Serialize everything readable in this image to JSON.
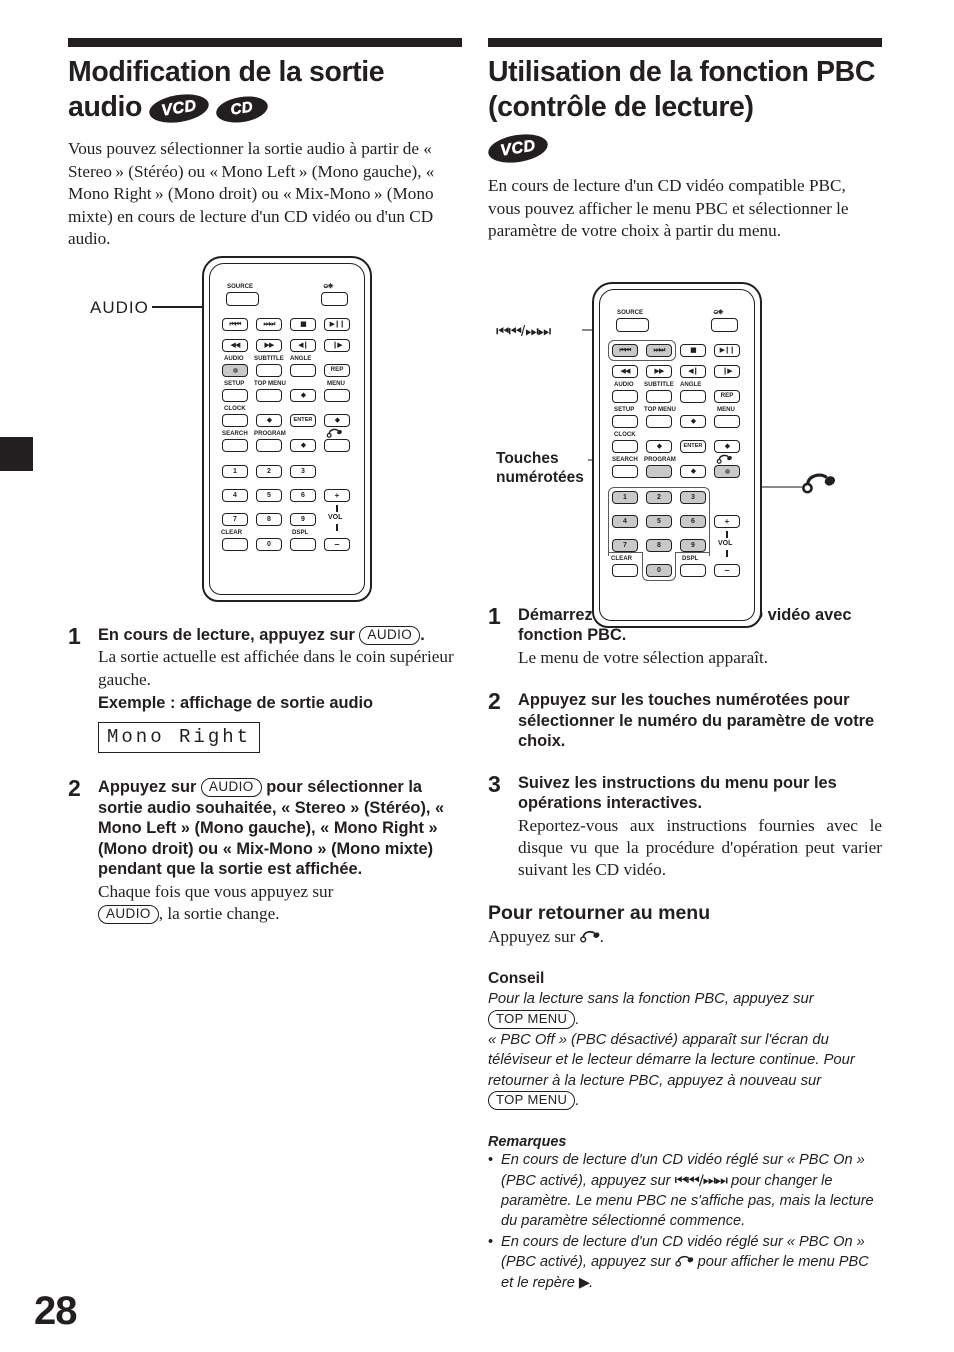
{
  "page": {
    "number": "28"
  },
  "left_column": {
    "title": "Modification de la sortie audio",
    "badges": [
      "VCD",
      "CD"
    ],
    "intro": "Vous pouvez sélectionner la sortie audio à partir de « Stereo » (Stéréo) ou « Mono Left » (Mono gauche), « Mono Right » (Mono droit) ou « Mix-Mono » (Mono mixte) en cours de lecture d'un CD vidéo ou d'un CD audio.",
    "remote_callout": "AUDIO",
    "steps": [
      {
        "num": "1",
        "head_before": "En cours de lecture, appuyez sur ",
        "head_key": "AUDIO",
        "head_after": ".",
        "sub": "La sortie actuelle est affichée dans le coin supérieur gauche.",
        "example_label": "Exemple : affichage de sortie audio",
        "lcd": "Mono Right"
      },
      {
        "num": "2",
        "head_before": "Appuyez sur ",
        "head_key": "AUDIO",
        "head_after": " pour sélectionner la sortie audio souhaitée, « Stereo » (Stéréo), « Mono Left » (Mono gauche), « Mono Right » (Mono droit) ou « Mix-Mono » (Mono mixte) pendant que la sortie est affichée.",
        "sub_before": "Chaque fois que vous appuyez sur ",
        "sub_key": "AUDIO",
        "sub_after": ", la sortie change."
      }
    ]
  },
  "right_column": {
    "title": "Utilisation de la fonction PBC (contrôle de lecture)",
    "badges": [
      "VCD"
    ],
    "intro": "En cours de lecture d'un CD vidéo compatible PBC, vous pouvez afficher le menu PBC et sélectionner le paramètre de votre choix à partir du menu.",
    "callouts": {
      "skip": "/",
      "numbered_keys_line1": "Touches",
      "numbered_keys_line2": "numérotées",
      "return_icon": "return-arrow-icon"
    },
    "steps": [
      {
        "num": "1",
        "head": "Démarrez la lecture avec un CD vidéo avec fonction PBC.",
        "sub": "Le menu de votre sélection apparaît."
      },
      {
        "num": "2",
        "head": "Appuyez sur les touches numérotées pour sélectionner le numéro du paramètre de votre choix.",
        "sub": ""
      },
      {
        "num": "3",
        "head": "Suivez les instructions du menu pour les opérations interactives.",
        "sub": "Reportez-vous aux instructions fournies avec le disque vu que la procédure d'opération peut varier suivant les CD vidéo."
      }
    ],
    "return_section": {
      "title": "Pour retourner au menu",
      "text_before": "Appuyez sur ",
      "text_after": "."
    },
    "tip": {
      "title": "Conseil",
      "line1_before": "Pour la lecture sans la fonction PBC, appuyez sur ",
      "line1_key": "TOP MENU",
      "line1_after": ".",
      "line2": "« PBC Off » (PBC désactivé) apparaît sur l'écran du téléviseur et le lecteur démarre la lecture continue. Pour retourner à la lecture PBC, appuyez à nouveau sur ",
      "line2_key": "TOP MENU",
      "line2_after": "."
    },
    "notes": {
      "title": "Remarques",
      "items": [
        {
          "before": "En cours de lecture d'un CD vidéo réglé sur « PBC On » (PBC activé), appuyez sur ",
          "glyph": "skip-prev-next-icon",
          "after": " pour changer le paramètre. Le menu PBC ne s'affiche pas, mais la lecture du paramètre sélectionné commence."
        },
        {
          "before": "En cours de lecture d'un CD vidéo réglé sur « PBC On » (PBC activé), appuyez sur ",
          "glyph": "return-arrow-icon",
          "after": " pour afficher le menu PBC et le repère ",
          "glyph2": "play-triangle-icon",
          "after2": "."
        }
      ]
    }
  },
  "remote": {
    "buttons": {
      "source": "SOURCE",
      "power": "power-icon",
      "prev": "prev-icon",
      "next": "next-icon",
      "stop": "stop-icon",
      "play_pause": "play-pause-icon",
      "rew": "rew-icon",
      "ff": "ff-icon",
      "slow_rev": "slow-rev-icon",
      "step": "step-icon",
      "audio": "AUDIO",
      "subtitle": "SUBTITLE",
      "angle": "ANGLE",
      "rep": "REP",
      "setup": "SETUP",
      "top_menu": "TOP MENU",
      "menu": "MENU",
      "clock": "CLOCK",
      "enter": "ENTER",
      "search": "SEARCH",
      "program": "PROGRAM",
      "return": "return-arrow-icon",
      "clear": "CLEAR",
      "dspl": "DSPL",
      "vol": "VOL",
      "vol_plus": "+",
      "vol_minus": "–",
      "digits": [
        "1",
        "2",
        "3",
        "4",
        "5",
        "6",
        "7",
        "8",
        "9",
        "0"
      ]
    }
  }
}
